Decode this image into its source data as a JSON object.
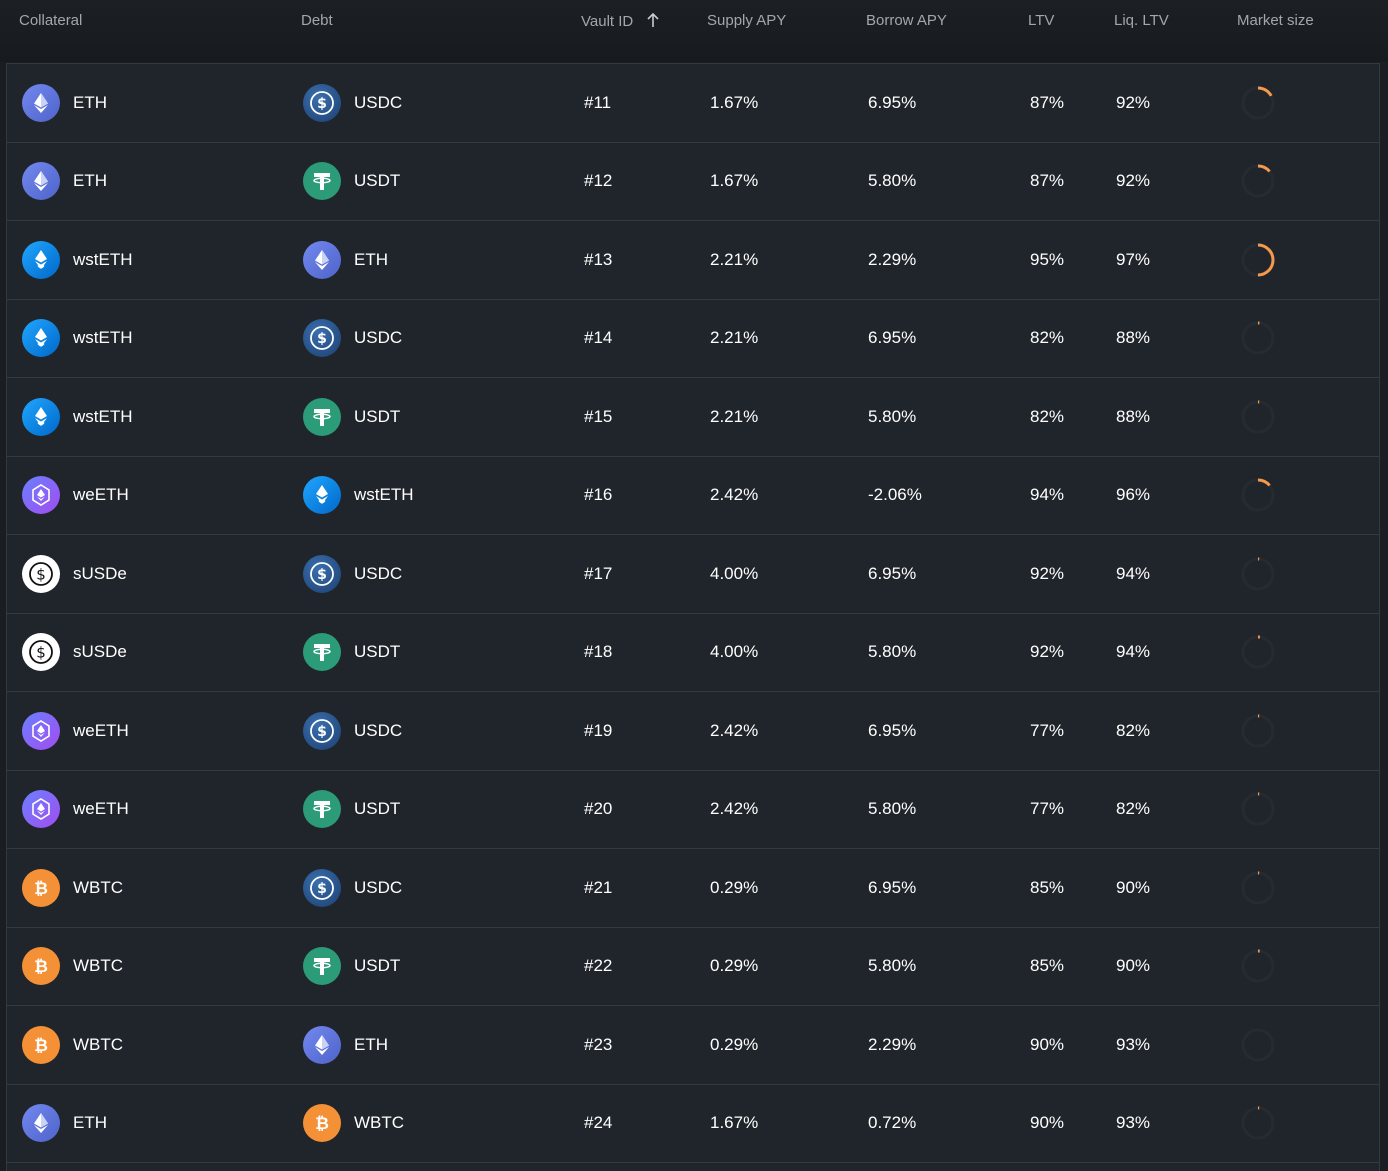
{
  "header": {
    "collateral": "Collateral",
    "debt": "Debt",
    "vault_id": "Vault ID",
    "supply_apy": "Supply APY",
    "borrow_apy": "Borrow APY",
    "ltv": "LTV",
    "liq_ltv": "Liq. LTV",
    "market_size": "Market size"
  },
  "colors": {
    "ETH": "#627eea",
    "USDC": "#2775ca",
    "USDT": "#26a17b",
    "wstETH": "#00a3ff",
    "weETH": "#7b5cf5",
    "sUSDe": "#ffffff",
    "WBTC": "#f7931a",
    "market_arc": "#f59a4a"
  },
  "rows": [
    {
      "collateral": "ETH",
      "debt": "USDC",
      "vault_id": "#11",
      "supply_apy": "1.67%",
      "borrow_apy": "6.95%",
      "ltv": "87%",
      "liq_ltv": "92%",
      "market_fill": 0.17
    },
    {
      "collateral": "ETH",
      "debt": "USDT",
      "vault_id": "#12",
      "supply_apy": "1.67%",
      "borrow_apy": "5.80%",
      "ltv": "87%",
      "liq_ltv": "92%",
      "market_fill": 0.14
    },
    {
      "collateral": "wstETH",
      "debt": "ETH",
      "vault_id": "#13",
      "supply_apy": "2.21%",
      "borrow_apy": "2.29%",
      "ltv": "95%",
      "liq_ltv": "97%",
      "market_fill": 0.5
    },
    {
      "collateral": "wstETH",
      "debt": "USDC",
      "vault_id": "#14",
      "supply_apy": "2.21%",
      "borrow_apy": "6.95%",
      "ltv": "82%",
      "liq_ltv": "88%",
      "market_fill": 0.015
    },
    {
      "collateral": "wstETH",
      "debt": "USDT",
      "vault_id": "#15",
      "supply_apy": "2.21%",
      "borrow_apy": "5.80%",
      "ltv": "82%",
      "liq_ltv": "88%",
      "market_fill": 0.012
    },
    {
      "collateral": "weETH",
      "debt": "wstETH",
      "vault_id": "#16",
      "supply_apy": "2.42%",
      "borrow_apy": "-2.06%",
      "ltv": "94%",
      "liq_ltv": "96%",
      "market_fill": 0.14
    },
    {
      "collateral": "sUSDe",
      "debt": "USDC",
      "vault_id": "#17",
      "supply_apy": "4.00%",
      "borrow_apy": "6.95%",
      "ltv": "92%",
      "liq_ltv": "94%",
      "market_fill": 0.006
    },
    {
      "collateral": "sUSDe",
      "debt": "USDT",
      "vault_id": "#18",
      "supply_apy": "4.00%",
      "borrow_apy": "5.80%",
      "ltv": "92%",
      "liq_ltv": "94%",
      "market_fill": 0.02
    },
    {
      "collateral": "weETH",
      "debt": "USDC",
      "vault_id": "#19",
      "supply_apy": "2.42%",
      "borrow_apy": "6.95%",
      "ltv": "77%",
      "liq_ltv": "82%",
      "market_fill": 0.008
    },
    {
      "collateral": "weETH",
      "debt": "USDT",
      "vault_id": "#20",
      "supply_apy": "2.42%",
      "borrow_apy": "5.80%",
      "ltv": "77%",
      "liq_ltv": "82%",
      "market_fill": 0.01
    },
    {
      "collateral": "WBTC",
      "debt": "USDC",
      "vault_id": "#21",
      "supply_apy": "0.29%",
      "borrow_apy": "6.95%",
      "ltv": "85%",
      "liq_ltv": "90%",
      "market_fill": 0.01
    },
    {
      "collateral": "WBTC",
      "debt": "USDT",
      "vault_id": "#22",
      "supply_apy": "0.29%",
      "borrow_apy": "5.80%",
      "ltv": "85%",
      "liq_ltv": "90%",
      "market_fill": 0.018
    },
    {
      "collateral": "WBTC",
      "debt": "ETH",
      "vault_id": "#23",
      "supply_apy": "0.29%",
      "borrow_apy": "2.29%",
      "ltv": "90%",
      "liq_ltv": "93%",
      "market_fill": 0.0
    },
    {
      "collateral": "ETH",
      "debt": "WBTC",
      "vault_id": "#24",
      "supply_apy": "1.67%",
      "borrow_apy": "0.72%",
      "ltv": "90%",
      "liq_ltv": "93%",
      "market_fill": 0.008
    }
  ]
}
